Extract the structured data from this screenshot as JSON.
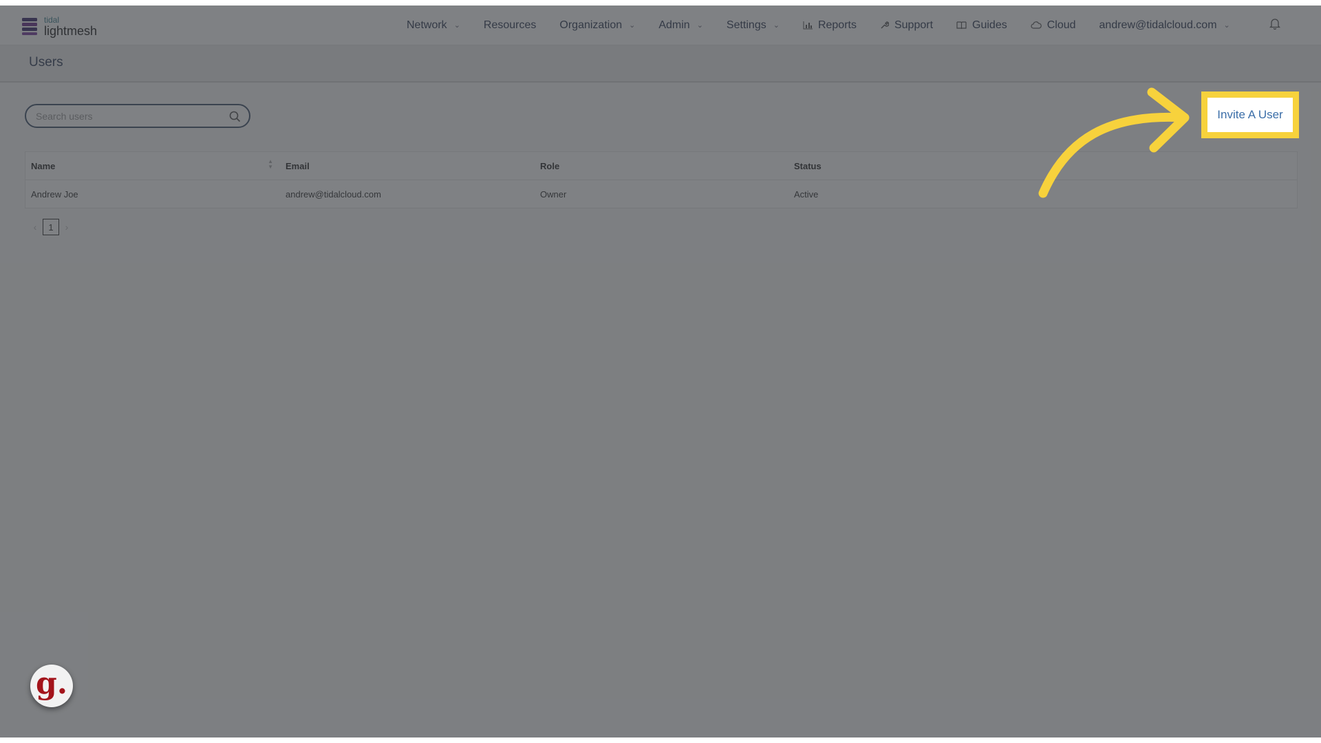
{
  "brand": {
    "small": "tidal",
    "name": "lightmesh",
    "logo_icon": "stacked-layers-icon"
  },
  "nav": {
    "items": [
      {
        "label": "Network",
        "dropdown": true
      },
      {
        "label": "Resources",
        "dropdown": false
      },
      {
        "label": "Organization",
        "dropdown": true
      },
      {
        "label": "Admin",
        "dropdown": true
      },
      {
        "label": "Settings",
        "dropdown": true
      },
      {
        "label": "Reports",
        "icon": "bar-chart-icon"
      },
      {
        "label": "Support",
        "icon": "wrench-icon"
      },
      {
        "label": "Guides",
        "icon": "book-icon"
      },
      {
        "label": "Cloud",
        "icon": "cloud-icon"
      }
    ],
    "user_email": "andrew@tidalcloud.com",
    "notifications_icon": "bell-icon"
  },
  "page": {
    "title": "Users"
  },
  "search": {
    "placeholder": "Search users",
    "value": "",
    "icon": "search-icon"
  },
  "invite_button": {
    "label": "Invite A User"
  },
  "table": {
    "columns": [
      "Name",
      "Email",
      "Role",
      "Status"
    ],
    "rows": [
      {
        "name": "Andrew Joe",
        "email": "andrew@tidalcloud.com",
        "role": "Owner",
        "status": "Active"
      }
    ]
  },
  "pagination": {
    "current_page": "1"
  },
  "widget": {
    "letter": "g."
  },
  "colors": {
    "highlight": "#f7d23c",
    "overlay": "#373a3e",
    "link": "#3b6ea8",
    "widget_text": "#a3141b"
  }
}
